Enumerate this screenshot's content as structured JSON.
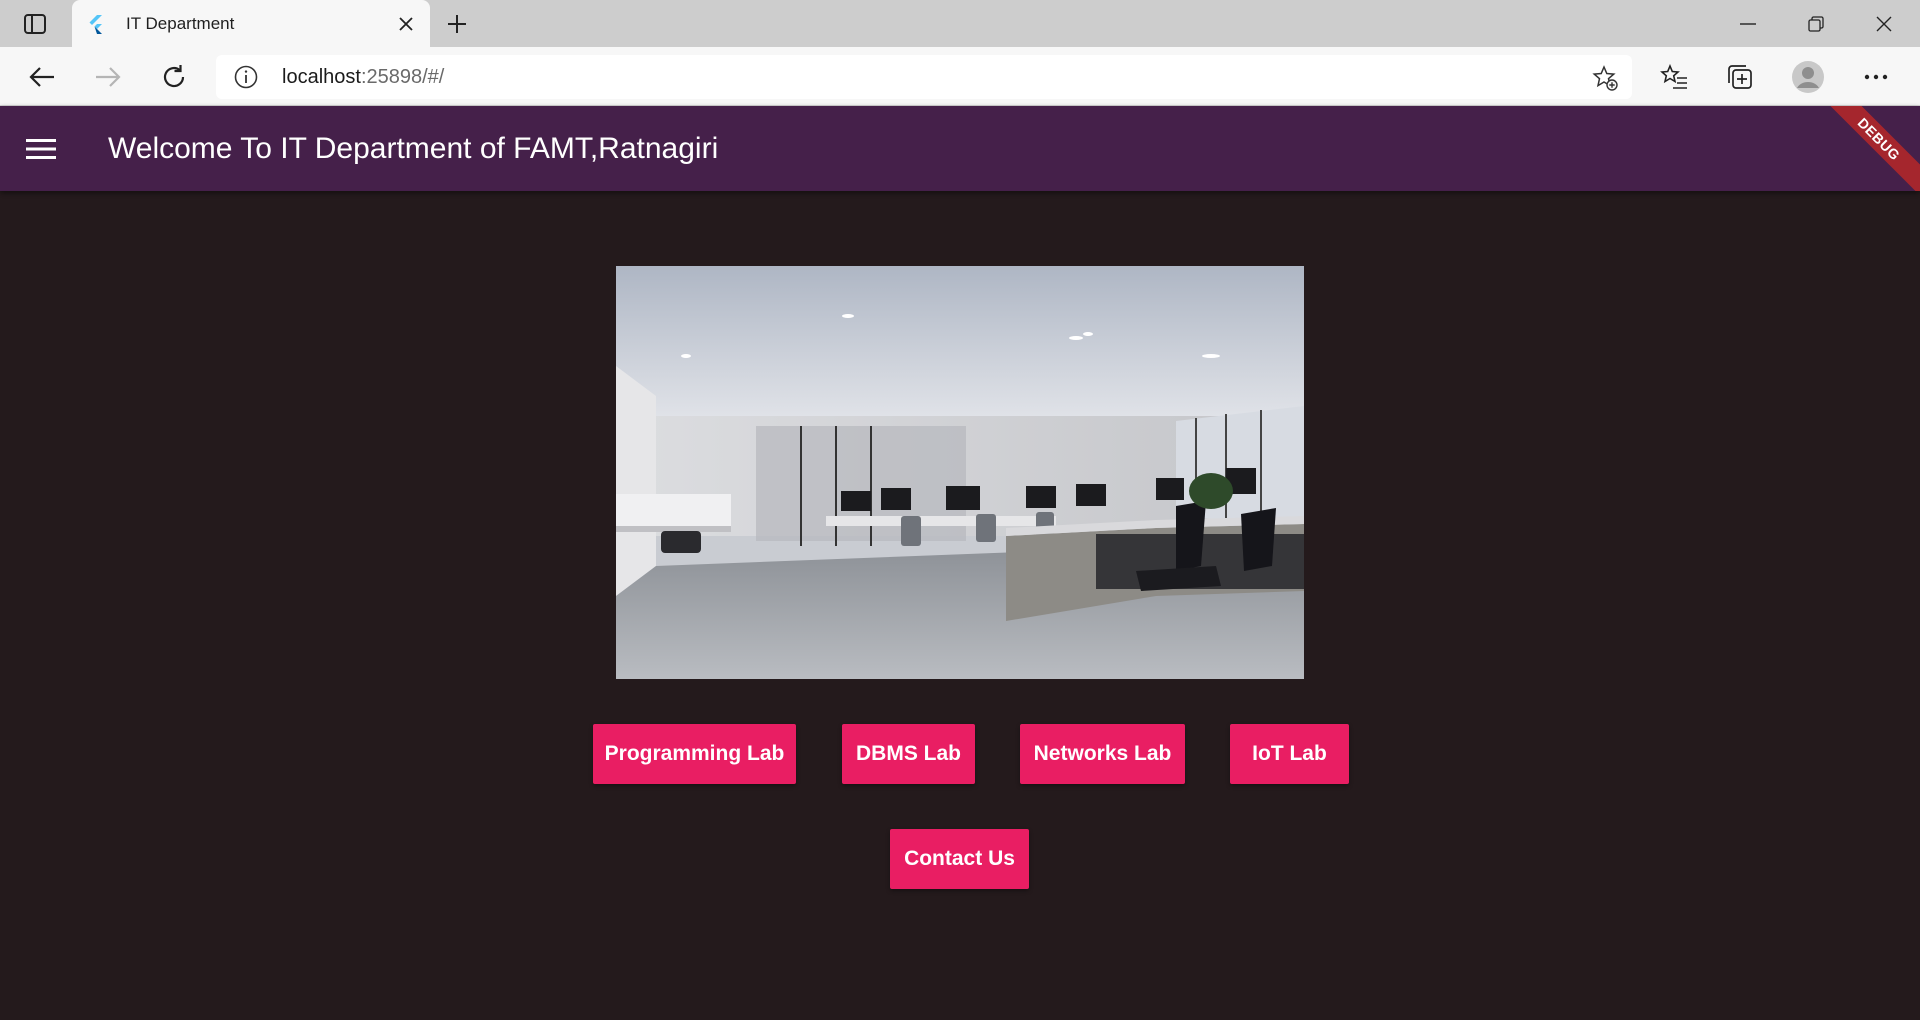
{
  "browser": {
    "tab_title": "IT Department",
    "url_host": "localhost",
    "url_rest": ":25898/#/"
  },
  "appbar": {
    "title": "Welcome To IT Department of FAMT,Ratnagiri",
    "debug_label": "DEBUG",
    "background": "#45204a"
  },
  "buttons": {
    "programming": "Programming Lab",
    "dbms": "DBMS Lab",
    "networks": "Networks Lab",
    "iot": "IoT Lab",
    "contact": "Contact Us",
    "color": "#e91e63"
  },
  "icons": [
    "tab-actions-icon",
    "flutter-icon",
    "close-icon",
    "plus-icon",
    "minimize-icon",
    "restore-icon",
    "back-arrow-icon",
    "forward-arrow-icon",
    "refresh-icon",
    "info-icon",
    "add-favorite-icon",
    "favorites-icon",
    "collections-icon",
    "profile-icon",
    "more-icon",
    "hamburger-icon"
  ]
}
